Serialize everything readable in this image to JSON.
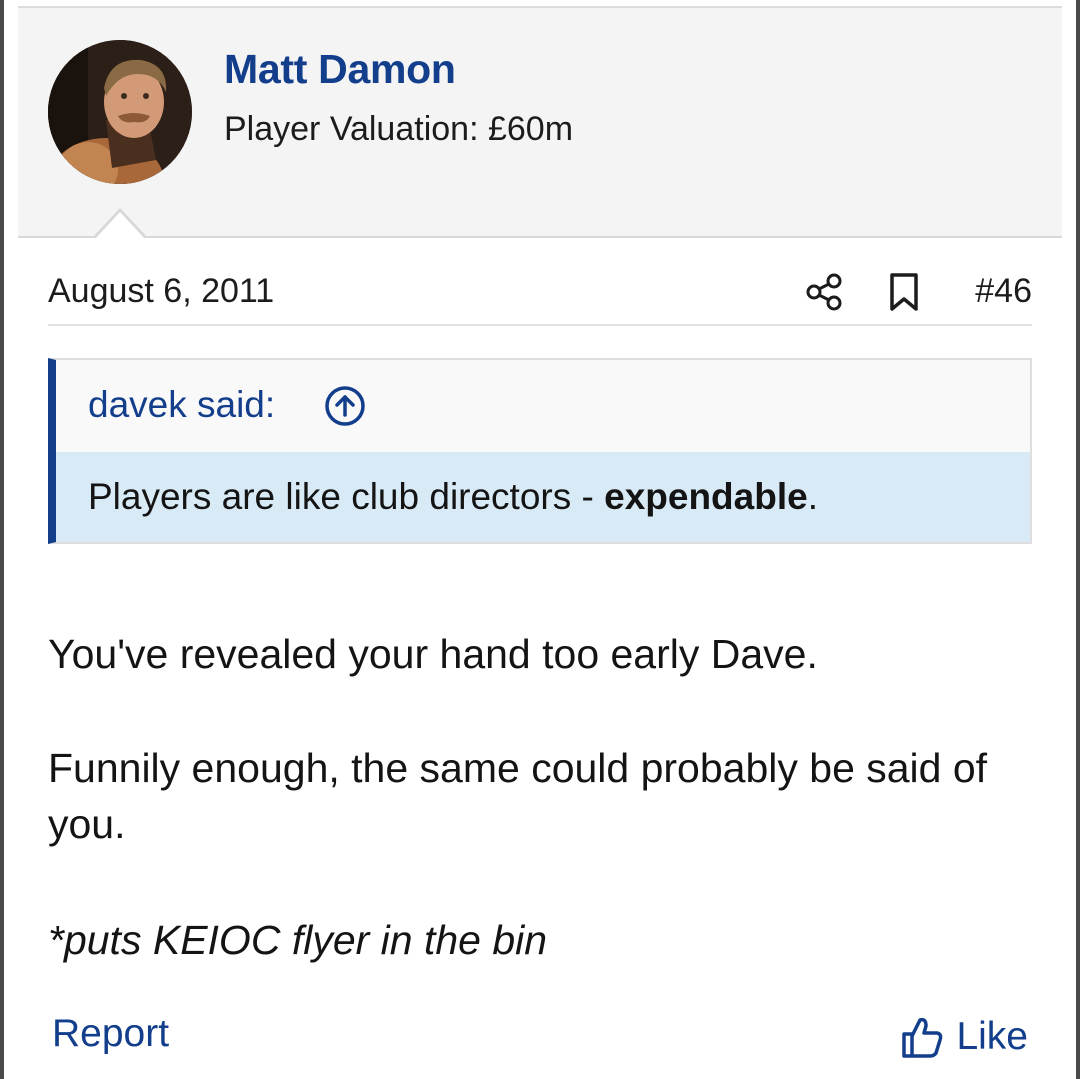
{
  "user": {
    "name": "Matt Damon",
    "valuation": "Player Valuation: £60m",
    "avatar_icon": "user-avatar-photo"
  },
  "post": {
    "date": "August 6, 2011",
    "number": "#46",
    "share_icon": "share-icon",
    "bookmark_icon": "bookmark-icon"
  },
  "quote": {
    "author": "davek said:",
    "arrow_icon": "arrow-up-circle-icon",
    "text_plain": "Players are like club directors - ",
    "text_bold": "expendable",
    "text_end": "."
  },
  "message": {
    "line1": "You've revealed your hand too early Dave.",
    "line2": "Funnily enough, the same could probably be said of you.",
    "line3": "*puts KEIOC flyer in the bin"
  },
  "actions": {
    "report": "Report",
    "like": "Like",
    "like_icon": "thumbs-up-icon"
  },
  "colors": {
    "accent": "#123e8c",
    "quote_background": "#d9eaf7",
    "header_background": "#f4f4f4"
  }
}
